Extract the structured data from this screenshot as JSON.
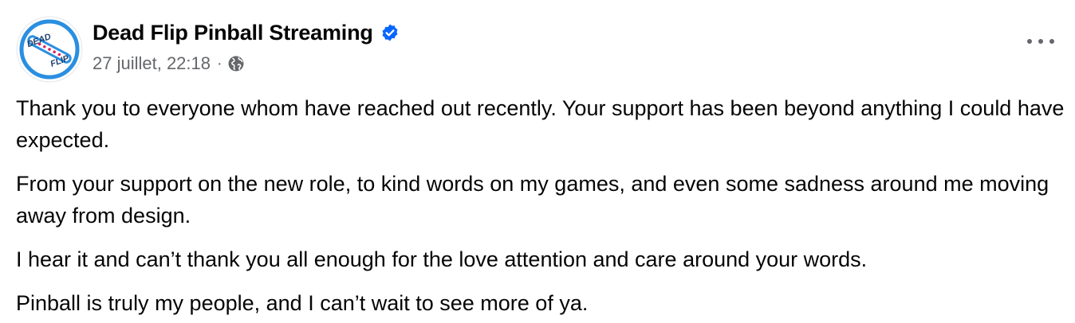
{
  "post": {
    "author": "Dead Flip Pinball Streaming",
    "verified": true,
    "timestamp": "27 juillet, 22:18",
    "separator": "·",
    "audience_icon": "globe-icon",
    "more_icon": "more-options-icon",
    "avatar": {
      "logo_text_top": "DEAD",
      "logo_text_bottom": "FLIP",
      "accent_color": "#2a8fe0"
    },
    "paragraphs": [
      "Thank you to everyone whom have reached out recently. Your support has been beyond anything I could have expected.",
      "From your support on the new role, to kind words on my games, and even some sadness around me moving away from design.",
      "I hear it and can’t thank you all enough for the love attention and care around your words.",
      "Pinball is truly my people, and I can’t wait to see more of ya."
    ]
  },
  "colors": {
    "verified_blue": "#0866ff",
    "secondary_text": "#65676b",
    "primary_text": "#050505"
  }
}
